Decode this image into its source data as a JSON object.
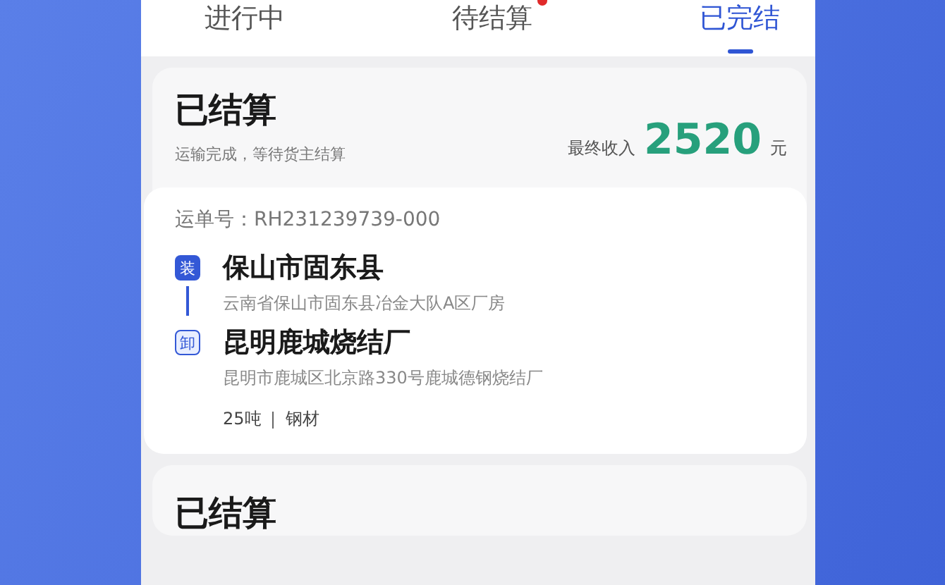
{
  "tabs": [
    {
      "label": "进行中",
      "selected": false,
      "dot": false
    },
    {
      "label": "待结算",
      "selected": false,
      "dot": true
    },
    {
      "label": "已完结",
      "selected": true,
      "dot": false
    }
  ],
  "orders": [
    {
      "status": "已结算",
      "note": "运输完成，等待货主结算",
      "income_label": "最终收入",
      "amount": "2520",
      "unit": "元",
      "waybill": "运单号：RH231239739-000",
      "stops": [
        {
          "kind": "load",
          "badge": "装",
          "name": "保山市固东县",
          "address": "云南省保山市固东县冶金大队A区厂房"
        },
        {
          "kind": "unload",
          "badge": "卸",
          "name": "昆明鹿城烧结厂",
          "address": "昆明市鹿城区北京路330号鹿城德钢烧结厂"
        }
      ],
      "cargo": [
        "25吨",
        "钢材"
      ]
    },
    {
      "status": "已结算"
    }
  ]
}
